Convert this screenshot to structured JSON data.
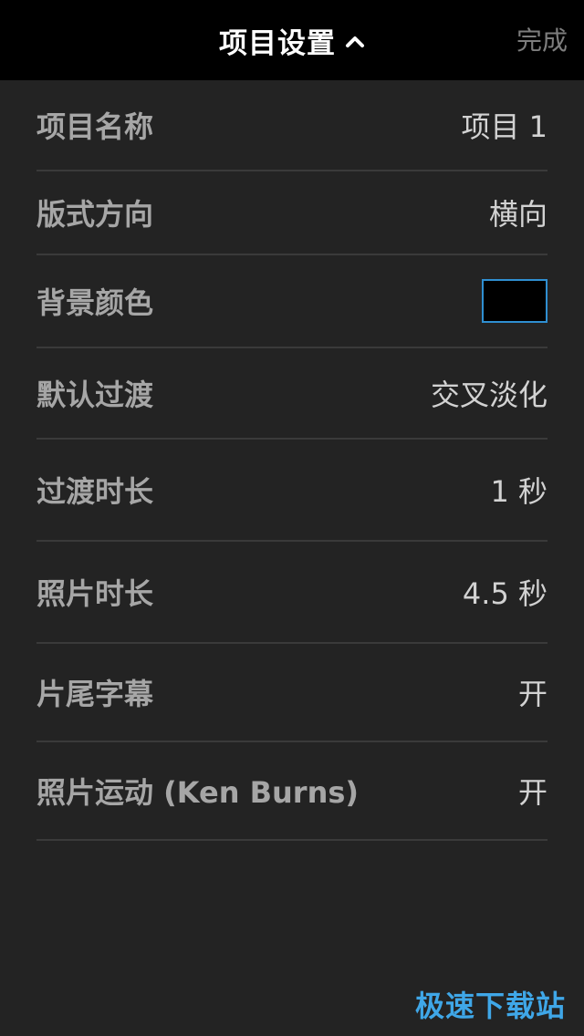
{
  "header": {
    "title": "项目设置",
    "done_label": "完成"
  },
  "settings": [
    {
      "label": "项目名称",
      "value": "项目 1"
    },
    {
      "label": "版式方向",
      "value": "横向"
    },
    {
      "label": "背景颜色",
      "color": "#000000",
      "swatch_border": "#2f8fd1"
    },
    {
      "label": "默认过渡",
      "value": "交叉淡化"
    },
    {
      "label": "过渡时长",
      "value": "1 秒"
    },
    {
      "label": "照片时长",
      "value": "4.5 秒"
    },
    {
      "label": "片尾字幕",
      "value": "开"
    },
    {
      "label": "照片运动 (Ken Burns)",
      "value": "开"
    }
  ],
  "watermark": "极速下载站",
  "colors": {
    "background": "#232323",
    "topbar": "#000000",
    "label": "#a6a6a6",
    "value": "#d2d2d2",
    "divider": "#3a3a3a",
    "watermark": "#3fa7e8"
  },
  "icons": {
    "title_chevron": "chevron-up-icon"
  }
}
